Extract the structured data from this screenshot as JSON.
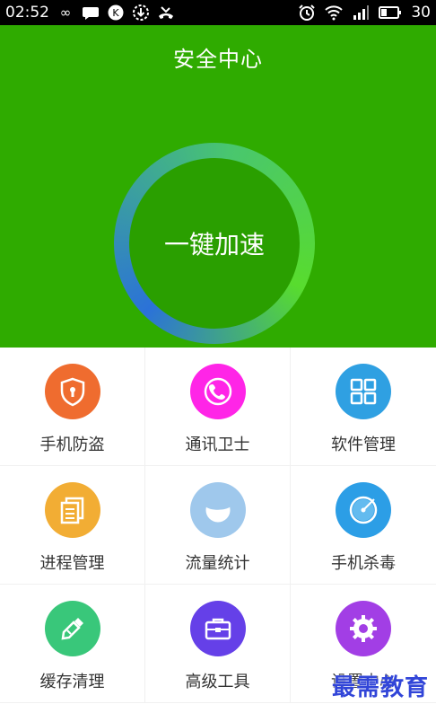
{
  "status_bar": {
    "time": "02:52",
    "battery": "30"
  },
  "hero": {
    "title": "安全中心",
    "accelerate_label": "一键加速",
    "bg_color": "#2fab00"
  },
  "features": [
    {
      "label": "手机防盗",
      "icon": "shield-icon",
      "color": "#ef6c2f"
    },
    {
      "label": "通讯卫士",
      "icon": "phone-icon",
      "color": "#ff25e7"
    },
    {
      "label": "软件管理",
      "icon": "apps-grid-icon",
      "color": "#2fa0e2"
    },
    {
      "label": "进程管理",
      "icon": "documents-icon",
      "color": "#f2ad34"
    },
    {
      "label": "流量统计",
      "icon": "flow-gauge-icon",
      "color": "#9fc8ec"
    },
    {
      "label": "手机杀毒",
      "icon": "radar-icon",
      "color": "#2c9ee6"
    },
    {
      "label": "缓存清理",
      "icon": "brush-icon",
      "color": "#39c77a"
    },
    {
      "label": "高级工具",
      "icon": "toolbox-icon",
      "color": "#6540e8"
    },
    {
      "label": "设置中心",
      "icon": "gear-icon",
      "color": "#a23ee5"
    }
  ],
  "watermark": "最需教育"
}
